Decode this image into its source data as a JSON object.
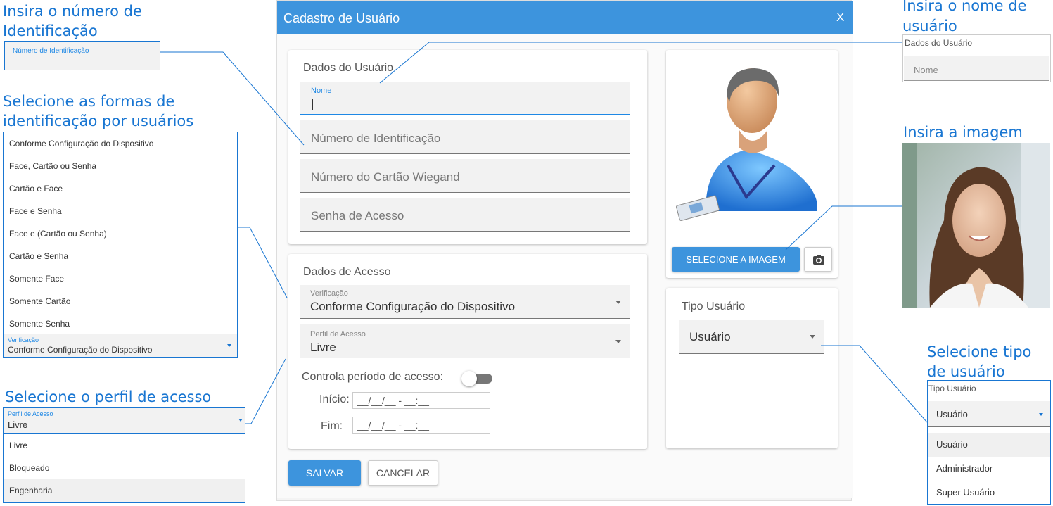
{
  "callouts": {
    "id_number": [
      "Insira o número de",
      "Identificação"
    ],
    "id_forms": [
      "Selecione as formas de",
      "identificação por usuários"
    ],
    "access_profile": "Selecione o perfil de acesso",
    "user_name": [
      "Insira o nome de",
      "usuário"
    ],
    "image": "Insira a imagem",
    "user_type": [
      "Selecione tipo",
      "de usuário"
    ]
  },
  "dialog": {
    "title": "Cadastro de Usuário",
    "close": "X",
    "user_data": {
      "title": "Dados do Usuário",
      "name_label": "Nome",
      "name_value": "",
      "id_number_placeholder": "Número de Identificação",
      "wiegand_placeholder": "Número do Cartão Wiegand",
      "password_placeholder": "Senha de Acesso"
    },
    "access_data": {
      "title": "Dados de Acesso",
      "verification_label": "Verificação",
      "verification_value": "Conforme Configuração do Dispositivo",
      "profile_label": "Perfil de Acesso",
      "profile_value": "Livre",
      "period_label": "Controla período de acesso:",
      "period_enabled": false,
      "start_label": "Início:",
      "start_value": "__/__/__ - __:__",
      "end_label": "Fim:",
      "end_value": "__/__/__ - __:__"
    },
    "image": {
      "select_button": "SELECIONE A IMAGEM",
      "camera_icon": "camera-icon"
    },
    "user_type": {
      "title": "Tipo Usuário",
      "value": "Usuário"
    },
    "buttons": {
      "save": "SALVAR",
      "cancel": "CANCELAR"
    }
  },
  "side_id_field": {
    "label": "Número de Identificação"
  },
  "side_verification": {
    "options": [
      "Conforme Configuração do Dispositivo",
      "Face, Cartão ou Senha",
      "Cartão e Face",
      "Face e Senha",
      "Face e (Cartão ou Senha)",
      "Cartão e Senha",
      "Somente Face",
      "Somente Cartão",
      "Somente Senha"
    ],
    "label": "Verificação",
    "value": "Conforme Configuração do Dispositivo"
  },
  "side_profile": {
    "label": "Perfil de Acesso",
    "value": "Livre",
    "options": [
      "Livre",
      "Bloqueado",
      "Engenharia"
    ]
  },
  "side_name": {
    "title": "Dados do Usuário",
    "placeholder": "Nome"
  },
  "side_user_type": {
    "title": "Tipo Usuário",
    "value": "Usuário",
    "options": [
      "Usuário",
      "Administrador",
      "Super Usuário"
    ]
  },
  "colors": {
    "accent": "#3d94dd",
    "callout": "#1976d2",
    "header": "#3d94dd"
  }
}
